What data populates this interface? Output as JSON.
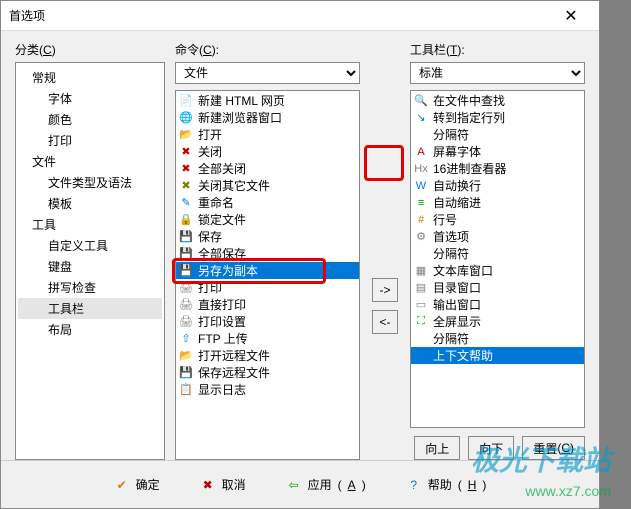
{
  "window": {
    "title": "首选项"
  },
  "labels": {
    "categories": "分类",
    "categories_key": "C",
    "commands": "命令",
    "commands_key": "C",
    "toolbar": "工具栏",
    "toolbar_key": "T",
    "move_up": "向上",
    "move_down": "向下",
    "reset": "重置",
    "reset_key": "C",
    "ok": "确定",
    "cancel": "取消",
    "apply": "应用",
    "apply_key": "A",
    "help": "帮助",
    "help_key": "H",
    "add": "->",
    "remove": "<-"
  },
  "category_tree": [
    {
      "label": "常规",
      "level": 1
    },
    {
      "label": "字体",
      "level": 2
    },
    {
      "label": "颜色",
      "level": 2
    },
    {
      "label": "打印",
      "level": 2
    },
    {
      "label": "文件",
      "level": 1
    },
    {
      "label": "文件类型及语法",
      "level": 2
    },
    {
      "label": "模板",
      "level": 2
    },
    {
      "label": "工具",
      "level": 1
    },
    {
      "label": "自定义工具",
      "level": 2
    },
    {
      "label": "键盘",
      "level": 2
    },
    {
      "label": "拼写检查",
      "level": 2
    },
    {
      "label": "工具栏",
      "level": 2,
      "selected": true
    },
    {
      "label": "布局",
      "level": 2
    }
  ],
  "commands_dropdown": {
    "selected": "文件"
  },
  "toolbar_dropdown": {
    "selected": "标准"
  },
  "commands_list": [
    {
      "label": "新建 HTML 网页",
      "icon": "📄",
      "color": "#d08000"
    },
    {
      "label": "新建浏览器窗口",
      "icon": "🌐",
      "color": "#0078d7"
    },
    {
      "label": "打开",
      "icon": "📂",
      "color": "#d08000"
    },
    {
      "label": "关闭",
      "icon": "✖",
      "color": "#c00000"
    },
    {
      "label": "全部关闭",
      "icon": "✖",
      "color": "#c00000"
    },
    {
      "label": "关闭其它文件",
      "icon": "✖",
      "color": "#808000"
    },
    {
      "label": "重命名",
      "icon": "✎",
      "color": "#0078d7"
    },
    {
      "label": "锁定文件",
      "icon": "🔒",
      "color": "#d08000"
    },
    {
      "label": "保存",
      "icon": "💾",
      "color": "#0078d7"
    },
    {
      "label": "全部保存",
      "icon": "💾",
      "color": "#0078d7"
    },
    {
      "label": "另存为副本",
      "icon": "💾",
      "color": "#00a000",
      "selected": true
    },
    {
      "label": "打印",
      "icon": "🖨",
      "color": "#808080"
    },
    {
      "label": "直接打印",
      "icon": "🖨",
      "color": "#808080"
    },
    {
      "label": "打印设置",
      "icon": "🖨",
      "color": "#808080"
    },
    {
      "label": "FTP 上传",
      "icon": "⇧",
      "color": "#0078d7"
    },
    {
      "label": "打开远程文件",
      "icon": "📂",
      "color": "#00a000"
    },
    {
      "label": "保存远程文件",
      "icon": "💾",
      "color": "#00a000"
    },
    {
      "label": "显示日志",
      "icon": "📋",
      "color": "#808080"
    }
  ],
  "toolbar_list": [
    {
      "label": "在文件中查找",
      "icon": "🔍",
      "color": "#d08000"
    },
    {
      "label": "转到指定行列",
      "icon": "↘",
      "color": "#0078d7"
    },
    {
      "label": "分隔符",
      "icon": "",
      "color": "#888"
    },
    {
      "label": "屏幕字体",
      "icon": "A",
      "color": "#c00000"
    },
    {
      "label": "16进制查看器",
      "icon": "Hx",
      "color": "#808080"
    },
    {
      "label": "自动换行",
      "icon": "W",
      "color": "#0078d7"
    },
    {
      "label": "自动缩进",
      "icon": "≡",
      "color": "#00a000"
    },
    {
      "label": "行号",
      "icon": "#",
      "color": "#d08000"
    },
    {
      "label": "首选项",
      "icon": "⚙",
      "color": "#808080"
    },
    {
      "label": "分隔符",
      "icon": "",
      "color": "#888"
    },
    {
      "label": "文本库窗口",
      "icon": "▦",
      "color": "#808080"
    },
    {
      "label": "目录窗口",
      "icon": "▤",
      "color": "#808080"
    },
    {
      "label": "输出窗口",
      "icon": "▭",
      "color": "#808080"
    },
    {
      "label": "全屏显示",
      "icon": "⛶",
      "color": "#00a000"
    },
    {
      "label": "分隔符",
      "icon": "",
      "color": "#888"
    },
    {
      "label": "上下文帮助",
      "icon": "?",
      "color": "#0078d7",
      "selected": true
    }
  ],
  "watermark": {
    "logo": "极光下载站",
    "url": "www.xz7.com"
  }
}
